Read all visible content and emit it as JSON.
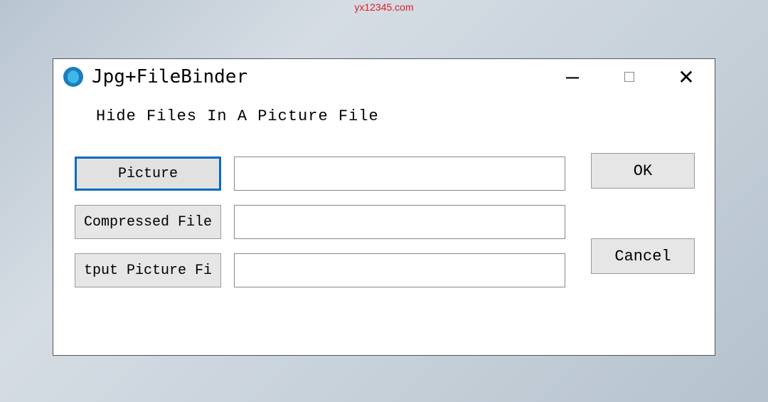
{
  "watermark": "yx12345.com",
  "window": {
    "title": "Jpg+FileBinder",
    "heading": "Hide Files In A Picture File"
  },
  "rows": [
    {
      "label": "Picture",
      "value": "",
      "focused": true
    },
    {
      "label": "Compressed File",
      "value": "",
      "focused": false
    },
    {
      "label": "tput Picture Fi",
      "value": "",
      "focused": false
    }
  ],
  "buttons": {
    "ok": "OK",
    "cancel": "Cancel"
  }
}
